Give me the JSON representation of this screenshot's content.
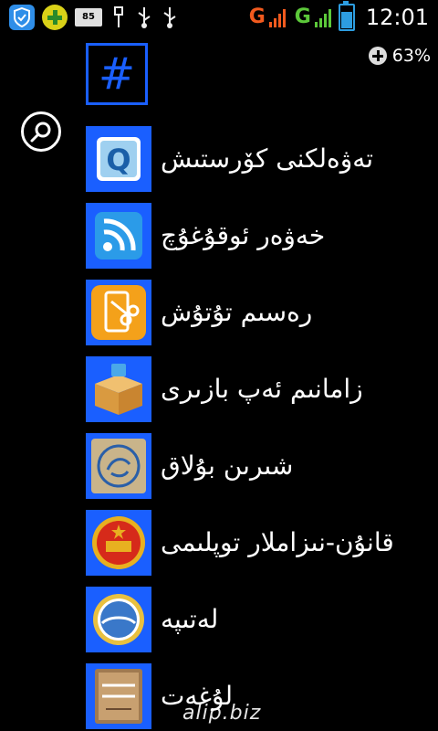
{
  "status_bar": {
    "time": "12:01",
    "network_1": "G",
    "network_2": "G",
    "battery_small_label": "85",
    "battery_level": 0.7
  },
  "memory": {
    "percent": "63%"
  },
  "jump_tile": {
    "label": "#"
  },
  "search": {
    "icon": "search-icon"
  },
  "apps": [
    {
      "label": "تەۋەلكنى كۆرستىش",
      "icon": "quick-q-icon",
      "color": "#4a90d9"
    },
    {
      "label": "خەۋەر ئوقۇغۇچ",
      "icon": "rss-reader-icon",
      "color": "#2b9be8"
    },
    {
      "label": "رەسىم تۇتۇش",
      "icon": "screenshot-scissors-icon",
      "color": "#f4a11a"
    },
    {
      "label": "زامانىم ئەپ بازىرى",
      "icon": "app-store-box-icon",
      "color": "#e8a040"
    },
    {
      "label": "شىرىن بۇلاق",
      "icon": "calligraphy-icon",
      "color": "#c9b48a"
    },
    {
      "label": "قانۇن-نىزاملار توپلىمى",
      "icon": "emblem-icon",
      "color": "#d62a1a"
    },
    {
      "label": "لەتىپە",
      "icon": "globe-badge-icon",
      "color": "#3a78c9"
    },
    {
      "label": "لۇغەت",
      "icon": "dictionary-icon",
      "color": "#a07a50"
    }
  ],
  "watermark": "alip.biz"
}
